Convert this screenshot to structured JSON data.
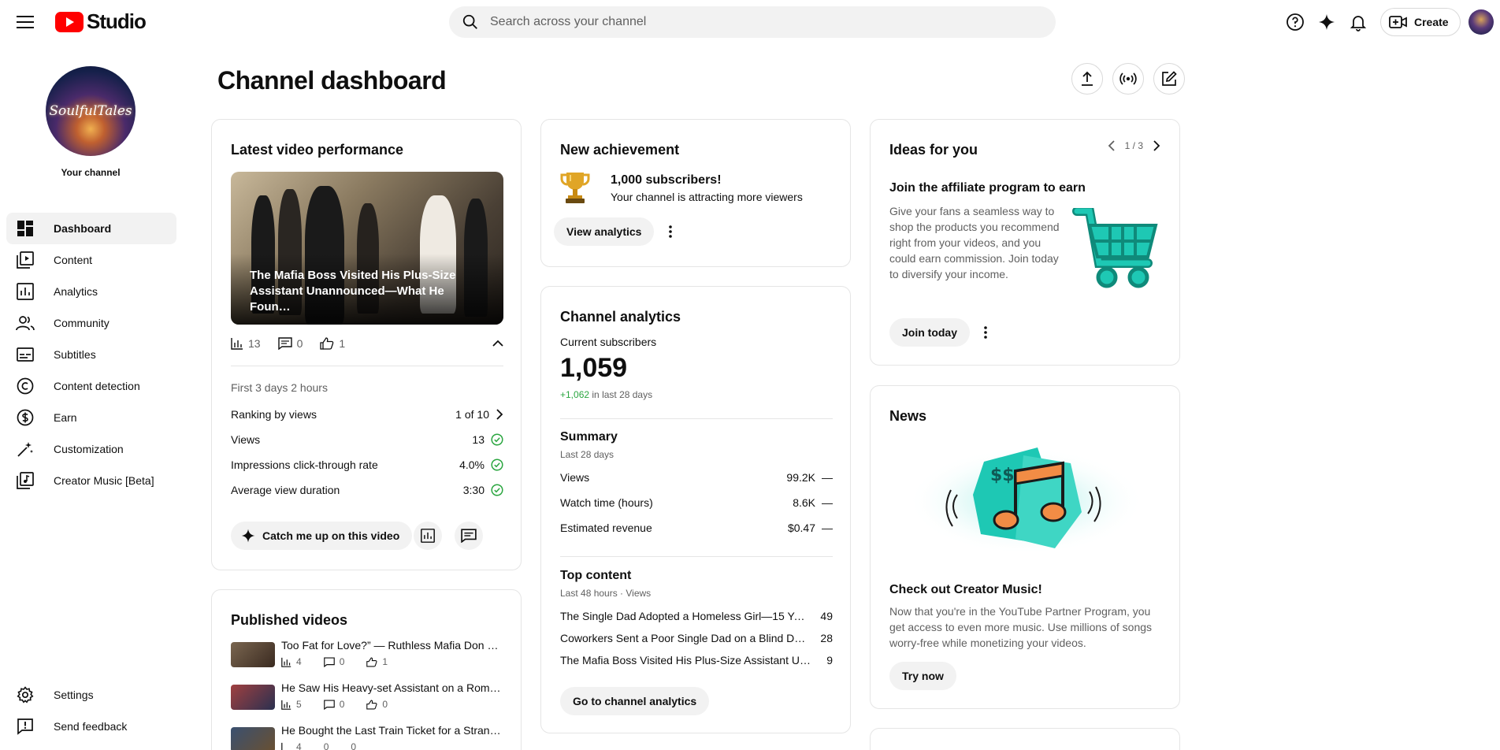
{
  "header": {
    "logo_text": "Studio",
    "search_placeholder": "Search across your channel",
    "create_label": "Create"
  },
  "sidebar": {
    "channel_label": "Your channel",
    "channel_logo_text": "SoulfulTales",
    "items": [
      {
        "label": "Dashboard",
        "icon": "dashboard-icon",
        "active": true
      },
      {
        "label": "Content",
        "icon": "content-icon"
      },
      {
        "label": "Analytics",
        "icon": "analytics-icon"
      },
      {
        "label": "Community",
        "icon": "community-icon"
      },
      {
        "label": "Subtitles",
        "icon": "subtitles-icon"
      },
      {
        "label": "Content detection",
        "icon": "copyright-icon"
      },
      {
        "label": "Earn",
        "icon": "earn-icon"
      },
      {
        "label": "Customization",
        "icon": "customization-icon"
      },
      {
        "label": "Creator Music [Beta]",
        "icon": "music-icon"
      }
    ],
    "bottom_items": [
      {
        "label": "Settings",
        "icon": "gear-icon"
      },
      {
        "label": "Send feedback",
        "icon": "feedback-icon"
      }
    ]
  },
  "page": {
    "title": "Channel dashboard"
  },
  "latest_video": {
    "title": "Latest video performance",
    "video_title": "The Mafia Boss Visited His Plus-Size Assistant Unannounced—What He Foun…",
    "views": "13",
    "comments": "0",
    "likes": "1",
    "period": "First 3 days 2 hours",
    "rows": [
      {
        "label": "Ranking by views",
        "value": "1 of 10"
      },
      {
        "label": "Views",
        "value": "13"
      },
      {
        "label": "Impressions click-through rate",
        "value": "4.0%"
      },
      {
        "label": "Average view duration",
        "value": "3:30"
      }
    ],
    "catch_up_label": "Catch me up on this video"
  },
  "published": {
    "title": "Published videos",
    "items": [
      {
        "title": "Too Fat for Love?” — Ruthless Mafia Don H…",
        "views": "4",
        "comments": "0",
        "likes": "1"
      },
      {
        "title": "He Saw His Heavy-set Assistant on a Roma…",
        "views": "5",
        "comments": "0",
        "likes": "0"
      },
      {
        "title": "He Bought the Last Train Ticket for a Stran…",
        "views": "4",
        "comments": "0",
        "likes": "0"
      }
    ]
  },
  "achievement": {
    "title": "New achievement",
    "headline": "1,000 subscribers!",
    "description": "Your channel is attracting more viewers",
    "button": "View analytics"
  },
  "analytics": {
    "title": "Channel analytics",
    "subs_label": "Current subscribers",
    "subs_value": "1,059",
    "subs_delta": "+1,062",
    "subs_delta_suffix": "in last 28 days",
    "summary_title": "Summary",
    "summary_period": "Last 28 days",
    "summary": [
      {
        "label": "Views",
        "value": "99.2K",
        "trend": "—"
      },
      {
        "label": "Watch time (hours)",
        "value": "8.6K",
        "trend": "—"
      },
      {
        "label": "Estimated revenue",
        "value": "$0.47",
        "trend": "—"
      }
    ],
    "top_title": "Top content",
    "top_period": "Last 48 hours · Views",
    "top": [
      {
        "title": "The Single Dad Adopted a Homeless Girl—15 Year…",
        "views": "49"
      },
      {
        "title": "Coworkers Sent a Poor Single Dad on a Blind Date…",
        "views": "28"
      },
      {
        "title": "The Mafia Boss Visited His Plus-Size Assistant Un…",
        "views": "9"
      }
    ],
    "button": "Go to channel analytics"
  },
  "ideas": {
    "title": "Ideas for you",
    "pager": "1 / 3",
    "headline": "Join the affiliate program to earn",
    "body": "Give your fans a seamless way to shop the products you recommend right from your videos, and you could earn commission. Join today to diversify your income.",
    "button": "Join today"
  },
  "news": {
    "title": "News",
    "headline": "Check out Creator Music!",
    "body": "Now that you're in the YouTube Partner Program, you get access to even more music. Use millions of songs worry-free while monetizing your videos.",
    "button": "Try now"
  },
  "colors": {
    "brand_red": "#ff0000",
    "positive_green": "#2ba640",
    "accent_teal": "#1ec8b4"
  }
}
